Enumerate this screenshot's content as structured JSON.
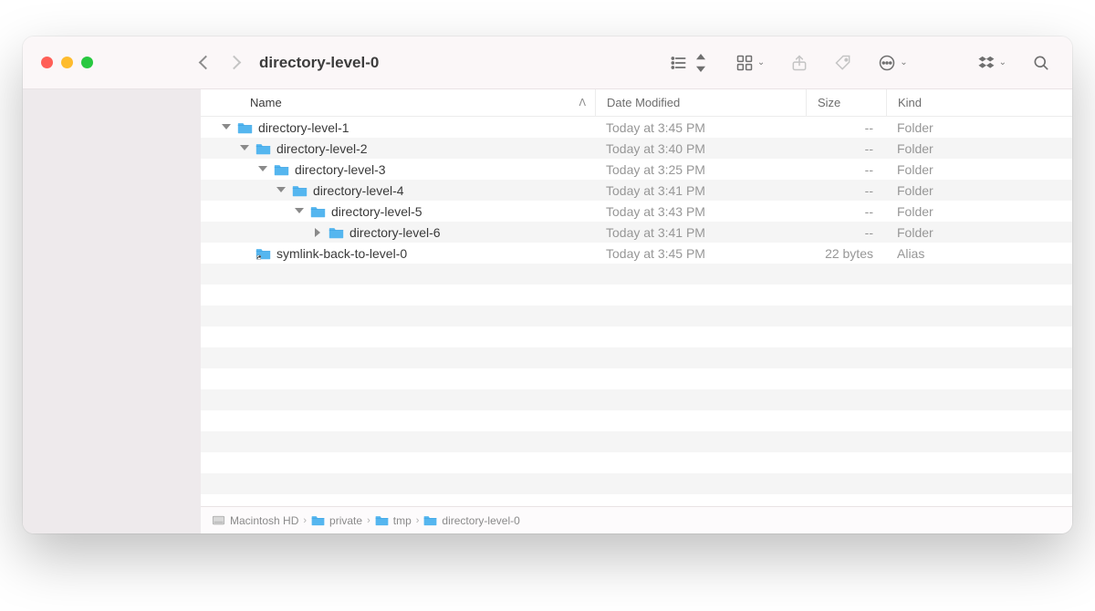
{
  "title": "directory-level-0",
  "columns": {
    "name": "Name",
    "date": "Date Modified",
    "size": "Size",
    "kind": "Kind"
  },
  "rows": [
    {
      "indent": 0,
      "disclosure": "open",
      "icon": "folder",
      "name": "directory-level-1",
      "date": "Today at 3:45 PM",
      "size": "--",
      "kind": "Folder"
    },
    {
      "indent": 1,
      "disclosure": "open",
      "icon": "folder",
      "name": "directory-level-2",
      "date": "Today at 3:40 PM",
      "size": "--",
      "kind": "Folder"
    },
    {
      "indent": 2,
      "disclosure": "open",
      "icon": "folder",
      "name": "directory-level-3",
      "date": "Today at 3:25 PM",
      "size": "--",
      "kind": "Folder"
    },
    {
      "indent": 3,
      "disclosure": "open",
      "icon": "folder",
      "name": "directory-level-4",
      "date": "Today at 3:41 PM",
      "size": "--",
      "kind": "Folder"
    },
    {
      "indent": 4,
      "disclosure": "open",
      "icon": "folder",
      "name": "directory-level-5",
      "date": "Today at 3:43 PM",
      "size": "--",
      "kind": "Folder"
    },
    {
      "indent": 5,
      "disclosure": "closed",
      "icon": "folder",
      "name": "directory-level-6",
      "date": "Today at 3:41 PM",
      "size": "--",
      "kind": "Folder"
    },
    {
      "indent": 1,
      "disclosure": "none",
      "icon": "alias",
      "name": "symlink-back-to-level-0",
      "date": "Today at 3:45 PM",
      "size": "22 bytes",
      "kind": "Alias"
    }
  ],
  "path": [
    {
      "icon": "disk",
      "label": "Macintosh HD"
    },
    {
      "icon": "folder",
      "label": "private"
    },
    {
      "icon": "folder",
      "label": "tmp"
    },
    {
      "icon": "folder",
      "label": "directory-level-0"
    }
  ]
}
